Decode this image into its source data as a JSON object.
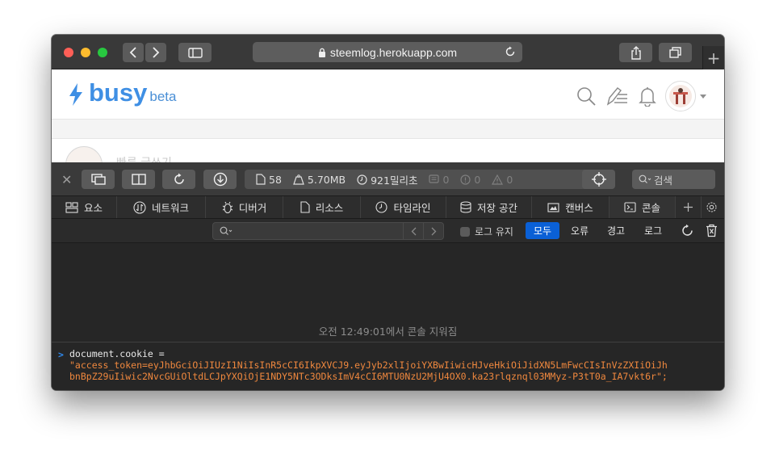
{
  "browser": {
    "url": "steemlog.herokuapp.com",
    "new_tab_label": "+"
  },
  "site": {
    "logo_text": "busy",
    "logo_badge": "beta",
    "card_text": "빠른 글쓰기",
    "colors": {
      "brand": "#3f8fe4"
    }
  },
  "devtools": {
    "stats": {
      "resources": "58",
      "size": "5.70MB",
      "time": "921밀리초",
      "logs": "0",
      "errors": "0",
      "warnings": "0"
    },
    "search_placeholder": "검색",
    "tabs": [
      {
        "label": "요소",
        "icon": "elements-icon"
      },
      {
        "label": "네트워크",
        "icon": "network-icon"
      },
      {
        "label": "디버거",
        "icon": "debugger-icon"
      },
      {
        "label": "리소스",
        "icon": "resources-icon"
      },
      {
        "label": "타임라인",
        "icon": "timeline-icon"
      },
      {
        "label": "저장 공간",
        "icon": "storage-icon"
      },
      {
        "label": "캔버스",
        "icon": "canvas-icon"
      },
      {
        "label": "콘솔",
        "icon": "console-icon"
      }
    ],
    "filter": {
      "placeholder": "",
      "preserve_log": "로그 유지",
      "levels": [
        "모두",
        "오류",
        "경고",
        "로그"
      ],
      "active_level": "모두"
    },
    "console": {
      "cleared_message": "오전 12:49:01에서 콘솔 지워짐",
      "prompt": ">",
      "command": "document.cookie =",
      "result_line1": "\"access_token=eyJhbGciOiJIUzI1NiIsInR5cCI6IkpXVCJ9.eyJyb2xlIjoiYXBwIiwicHJveHkiOiJidXN5LmFwcCIsInVzZXIiOiJh",
      "result_line2": "bnBpZ29uIiwic2NvcGUiOltdLCJpYXQiOjE1NDY5NTc3ODksImV4cCI6MTU0NzU2MjU4OX0.ka23rlqznql03MMyz-P3tT0a_IA7vkt6r\";"
    }
  }
}
